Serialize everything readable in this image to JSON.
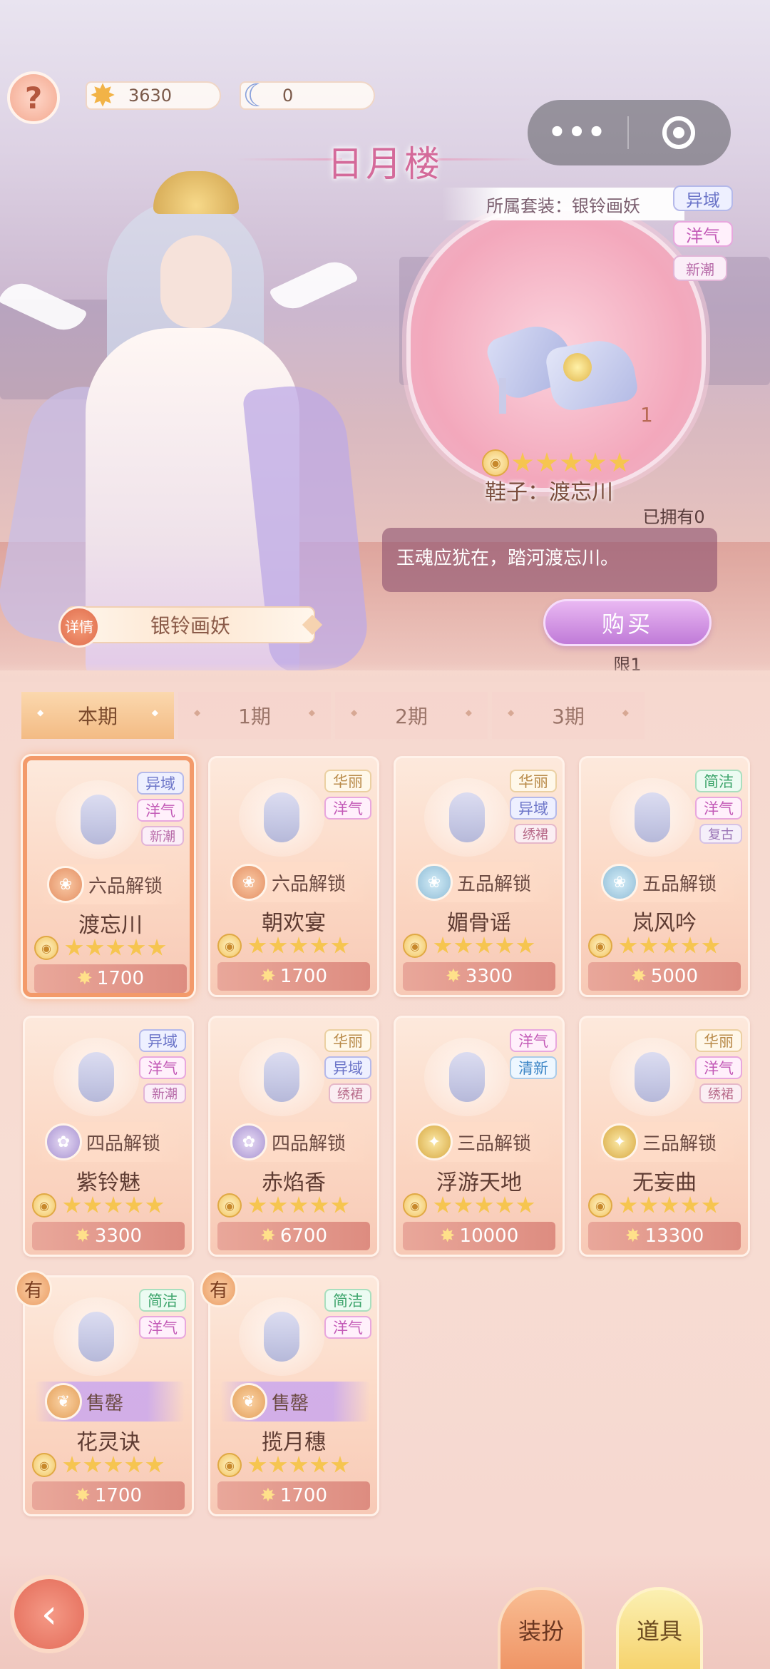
{
  "hud": {
    "gold": "3630",
    "moon": "0",
    "help_glyph": "?"
  },
  "capsule": {
    "menu_glyph": "•••"
  },
  "shop": {
    "title": "日月楼"
  },
  "outfit": {
    "name": "银铃画妖",
    "detail_label": "详情"
  },
  "item": {
    "suit_label": "所属套装：银铃画妖",
    "tags": [
      "异域",
      "洋气",
      "新潮"
    ],
    "quantity": "1",
    "stars": 5,
    "name": "鞋子：渡忘川",
    "owned": "已拥有0",
    "description": "玉魂应犹在，踏河渡忘川。",
    "buy_label": "购买",
    "limit": "限1"
  },
  "tabs": [
    "本期",
    "1期",
    "2期",
    "3期"
  ],
  "active_tab": 0,
  "cards": [
    {
      "name": "渡忘川",
      "tags": [
        "异域",
        "洋气",
        "新潮"
      ],
      "unlock": "六品解锁",
      "price": "1700",
      "stars": 5,
      "selected": true,
      "owned": false
    },
    {
      "name": "朝欢宴",
      "tags": [
        "华丽",
        "洋气"
      ],
      "unlock": "六品解锁",
      "price": "1700",
      "stars": 5,
      "selected": false,
      "owned": false
    },
    {
      "name": "媚骨谣",
      "tags": [
        "华丽",
        "异域",
        "绣裙"
      ],
      "unlock": "五品解锁",
      "price": "3300",
      "stars": 5,
      "selected": false,
      "owned": false
    },
    {
      "name": "岚风吟",
      "tags": [
        "简洁",
        "洋气",
        "复古"
      ],
      "unlock": "五品解锁",
      "price": "5000",
      "stars": 5,
      "selected": false,
      "owned": false
    },
    {
      "name": "紫铃魅",
      "tags": [
        "异域",
        "洋气",
        "新潮"
      ],
      "unlock": "四品解锁",
      "price": "3300",
      "stars": 5,
      "selected": false,
      "owned": false
    },
    {
      "name": "赤焰香",
      "tags": [
        "华丽",
        "异域",
        "绣裙"
      ],
      "unlock": "四品解锁",
      "price": "6700",
      "stars": 5,
      "selected": false,
      "owned": false
    },
    {
      "name": "浮游天地",
      "tags": [
        "洋气",
        "清新"
      ],
      "unlock": "三品解锁",
      "price": "10000",
      "stars": 5,
      "selected": false,
      "owned": false
    },
    {
      "name": "无妄曲",
      "tags": [
        "华丽",
        "洋气",
        "绣裙"
      ],
      "unlock": "三品解锁",
      "price": "13300",
      "stars": 5,
      "selected": false,
      "owned": false
    },
    {
      "name": "花灵诀",
      "tags": [
        "简洁",
        "洋气"
      ],
      "unlock": "售罄",
      "price": "1700",
      "stars": 5,
      "selected": false,
      "owned": true
    },
    {
      "name": "揽月穗",
      "tags": [
        "简洁",
        "洋气"
      ],
      "unlock": "售罄",
      "price": "1700",
      "stars": 5,
      "selected": false,
      "owned": true
    }
  ],
  "owned_badge": "有",
  "bottom": {
    "dress_label": "装扮",
    "item_label": "道具"
  }
}
